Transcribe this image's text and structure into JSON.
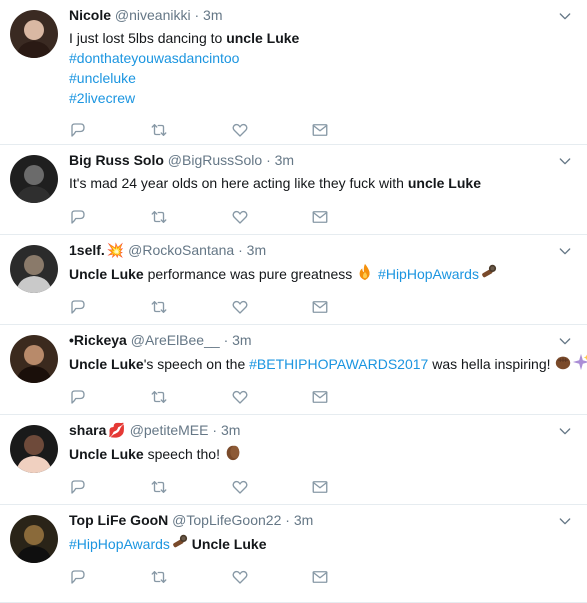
{
  "tweets": [
    {
      "name": "Nicole",
      "name_badge": "",
      "handle": "@niveanikki",
      "dot": "·",
      "time": "3m",
      "lines": [
        [
          {
            "t": "text",
            "v": "I just lost 5lbs dancing to "
          },
          {
            "t": "bold",
            "v": "uncle Luke"
          }
        ],
        [
          {
            "t": "tag",
            "v": "#donthateyouwasdancintoo"
          }
        ],
        [
          {
            "t": "tag",
            "v": "#uncleluke"
          }
        ],
        [
          {
            "t": "tag",
            "v": "#2livecrew"
          }
        ]
      ]
    },
    {
      "name": "Big Russ Solo",
      "name_badge": "",
      "handle": "@BigRussSolo",
      "dot": "·",
      "time": "3m",
      "lines": [
        [
          {
            "t": "text",
            "v": "It's mad 24 year olds on here acting like they fuck with "
          },
          {
            "t": "bold",
            "v": "uncle Luke"
          }
        ]
      ]
    },
    {
      "name": "1self.",
      "name_badge": "💥",
      "handle": "@RockoSantana",
      "dot": "·",
      "time": "3m",
      "lines": [
        [
          {
            "t": "bold",
            "v": "Uncle Luke"
          },
          {
            "t": "text",
            "v": " performance was pure greatness "
          },
          {
            "t": "emoji",
            "v": "fire"
          },
          {
            "t": "text",
            "v": " "
          },
          {
            "t": "tag",
            "v": "#HipHopAwards"
          },
          {
            "t": "emoji",
            "v": "mic"
          }
        ]
      ]
    },
    {
      "name": "•Rickeya",
      "name_badge": "",
      "handle": "@AreElBee__",
      "dot": "·",
      "time": "3m",
      "lines": [
        [
          {
            "t": "bold",
            "v": "Uncle Luke"
          },
          {
            "t": "text",
            "v": "'s speech on the "
          },
          {
            "t": "tag",
            "v": "#BETHIPHOPAWARDS2017"
          },
          {
            "t": "text",
            "v": " was hella inspiring! "
          },
          {
            "t": "emoji",
            "v": "fist"
          },
          {
            "t": "emoji",
            "v": "sparkle"
          }
        ]
      ]
    },
    {
      "name": "shara",
      "name_badge": "💋",
      "handle": "@petiteMEE",
      "dot": "·",
      "time": "3m",
      "lines": [
        [
          {
            "t": "bold",
            "v": "Uncle Luke"
          },
          {
            "t": "text",
            "v": " speech tho! "
          },
          {
            "t": "emoji",
            "v": "clap"
          }
        ]
      ]
    },
    {
      "name": "Top LiFe GooN",
      "name_badge": "",
      "handle": "@TopLifeGoon22",
      "dot": "·",
      "time": "3m",
      "lines": [
        [
          {
            "t": "tag",
            "v": "#HipHopAwards"
          },
          {
            "t": "emoji",
            "v": "mic"
          },
          {
            "t": "text",
            "v": " "
          },
          {
            "t": "bold",
            "v": "Uncle Luke"
          }
        ]
      ]
    }
  ],
  "icons": {
    "reply": "reply-icon",
    "retweet": "retweet-icon",
    "like": "heart-icon",
    "dm": "envelope-icon",
    "caret": "chevron-down-icon"
  },
  "colors": {
    "hashtag": "#1b95e0",
    "muted": "#657786",
    "text": "#14171a",
    "divider": "#e6ecf0"
  }
}
